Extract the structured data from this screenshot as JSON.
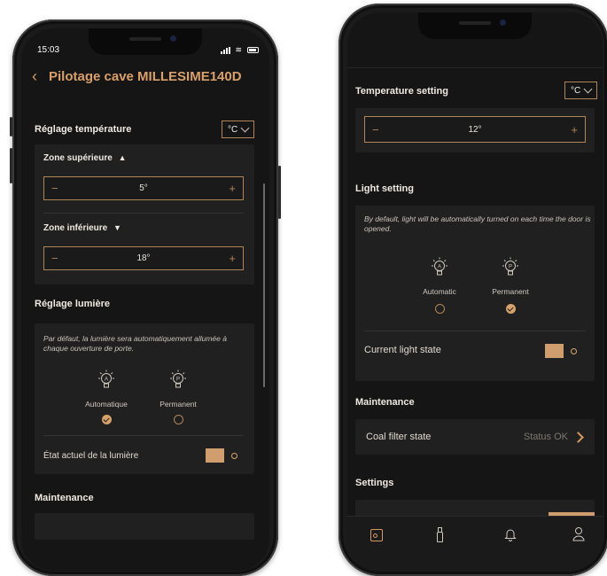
{
  "left_phone": {
    "status_bar": {
      "time": "15:03"
    },
    "header": {
      "title": "Pilotage cave MILLESIME140D"
    },
    "temperature": {
      "title": "Réglage température",
      "unit": "°C",
      "upper_zone": {
        "label": "Zone supérieure",
        "arrow": "▲",
        "value": "5°",
        "minus": "−",
        "plus": "+"
      },
      "lower_zone": {
        "label": "Zone inférieure",
        "arrow": "▼",
        "value": "18°",
        "minus": "−",
        "plus": "+"
      }
    },
    "light": {
      "title": "Réglage lumière",
      "description": "Par défaut, la lumière sera automatiquement allumée à chaque ouverture de porte.",
      "options": [
        {
          "label": "Automatique",
          "letter": "A",
          "selected": true
        },
        {
          "label": "Permanent",
          "letter": "P",
          "selected": false
        }
      ],
      "current_state_label": "État actuel de la lumière",
      "toggle_on": true
    },
    "maintenance": {
      "title": "Maintenance"
    }
  },
  "right_phone": {
    "temperature": {
      "title": "Temperature setting",
      "unit": "°C",
      "value": "12°",
      "minus": "−",
      "plus": "+"
    },
    "light": {
      "title": "Light setting",
      "description": "By default, light will be automatically turned on each time the door is opened.",
      "options": [
        {
          "label": "Automatic",
          "letter": "A",
          "selected": false
        },
        {
          "label": "Permanent",
          "letter": "P",
          "selected": true
        }
      ],
      "current_state_label": "Current light state",
      "toggle_on": true
    },
    "maintenance": {
      "title": "Maintenance",
      "coal_filter_label": "Coal filter state",
      "coal_filter_status": "Status OK"
    },
    "settings": {
      "title": "Settings"
    },
    "tab_bar": {
      "items": [
        {
          "icon": "wine-cellar-icon",
          "active": true
        },
        {
          "icon": "bottle-icon",
          "active": false
        },
        {
          "icon": "bell-icon",
          "active": false
        },
        {
          "icon": "user-icon",
          "active": false
        }
      ]
    }
  },
  "colors": {
    "accent": "#b08558",
    "background": "#151515",
    "panel": "#202020",
    "toggle": "#cf9d6e"
  }
}
